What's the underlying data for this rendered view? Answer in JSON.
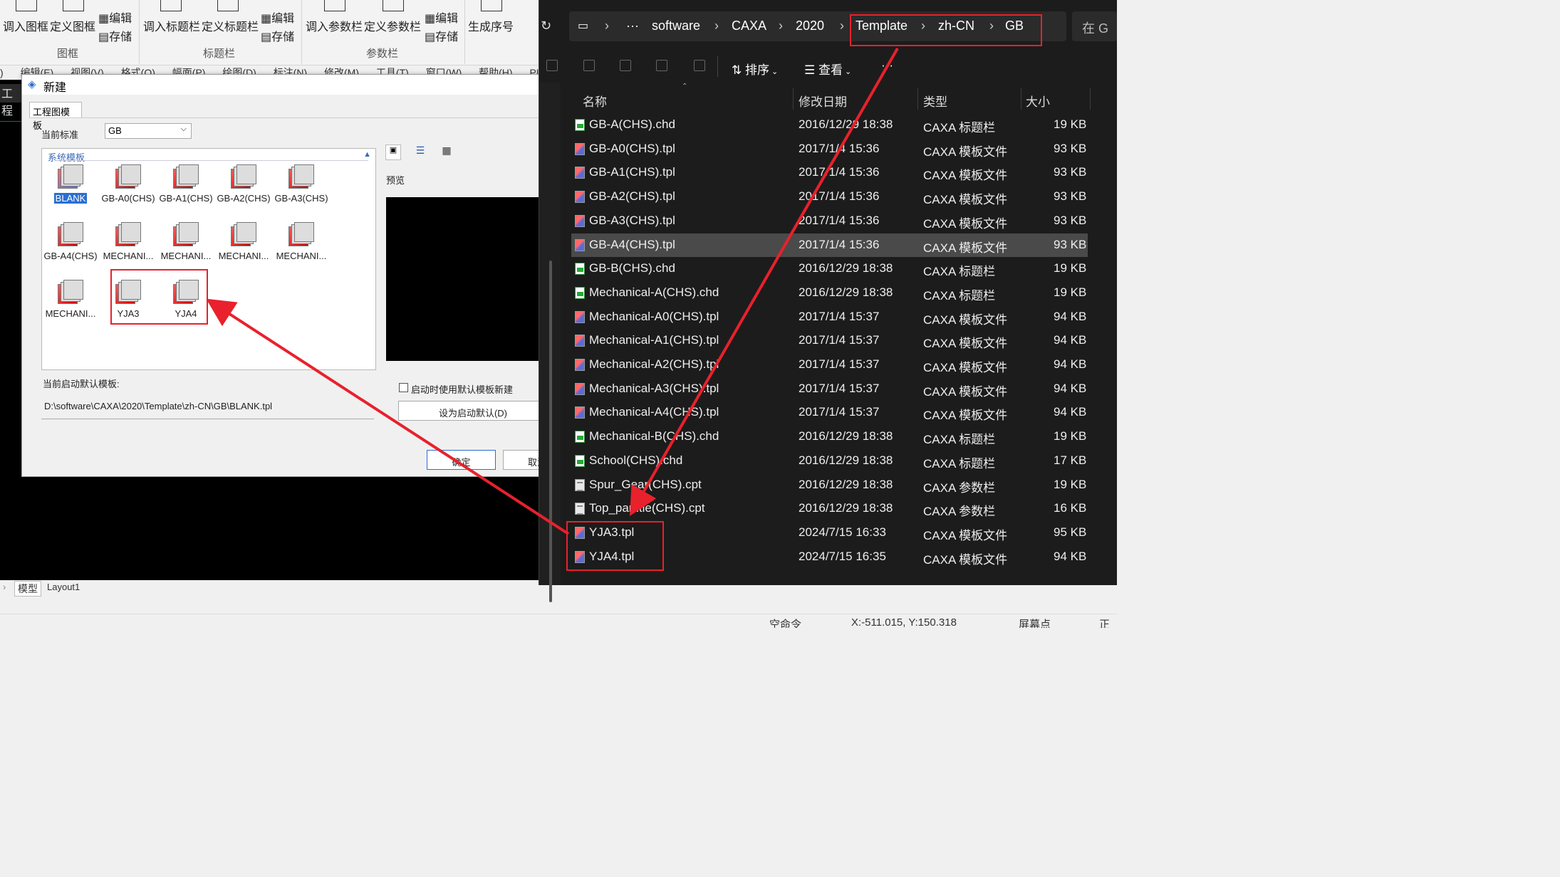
{
  "ribbon": {
    "groups": [
      {
        "name": "图框",
        "buttons": [
          "调入图框",
          "定义图框"
        ],
        "small": [
          "编辑",
          "存储"
        ]
      },
      {
        "name": "标题栏",
        "buttons": [
          "调入标题栏",
          "定义标题栏"
        ],
        "small": [
          "编辑",
          "存储"
        ]
      },
      {
        "name": "参数栏",
        "buttons": [
          "调入参数栏",
          "定义参数栏"
        ],
        "small": [
          "编辑",
          "存储"
        ]
      }
    ],
    "generate_serial": "生成序号"
  },
  "menubar": [
    "编辑(E)",
    "视图(V)",
    "格式(O)",
    "幅面(P)",
    "绘图(D)",
    "标注(N)",
    "修改(M)",
    "工具(T)",
    "窗口(W)",
    "帮助(H)",
    "PLM"
  ],
  "cad": {
    "project_label": "工程",
    "tabs": [
      "模型",
      "Layout1"
    ]
  },
  "status": {
    "command": "空命令",
    "coords": "X:-511.015, Y:150.318",
    "screen_point": "屏幕点",
    "ortho": "正交"
  },
  "dialog": {
    "title": "新建",
    "tab": "工程图模板",
    "current_standard_label": "当前标准",
    "current_standard_value": "GB",
    "system_templates_label": "系统模板",
    "templates": [
      "BLANK",
      "GB-A0(CHS)",
      "GB-A1(CHS)",
      "GB-A2(CHS)",
      "GB-A3(CHS)",
      "GB-A4(CHS)",
      "MECHANI...",
      "MECHANI...",
      "MECHANI...",
      "MECHANI...",
      "MECHANI...",
      "YJA3",
      "YJA4"
    ],
    "preview_label": "预览",
    "default_template_label": "当前启动默认模板:",
    "default_template_path": "D:\\software\\CAXA\\2020\\Template\\zh-CN\\GB\\BLANK.tpl",
    "checkbox_label": "启动时使用默认模板新建",
    "set_default_button": "设为启动默认(D)",
    "ok_button": "确定",
    "cancel_button": "取消"
  },
  "explorer": {
    "breadcrumb": [
      "software",
      "CAXA",
      "2020",
      "Template",
      "zh-CN",
      "GB"
    ],
    "search_placeholder": "在 G",
    "toolbar": {
      "sort": "排序",
      "view": "查看",
      "more": "···"
    },
    "columns": [
      "名称",
      "修改日期",
      "类型",
      "大小"
    ],
    "files": [
      {
        "name": "GB-A(CHS).chd",
        "date": "2016/12/29 18:38",
        "type": "CAXA 标题栏",
        "size": "19 KB",
        "kind": "chd"
      },
      {
        "name": "GB-A0(CHS).tpl",
        "date": "2017/1/4 15:36",
        "type": "CAXA 模板文件",
        "size": "93 KB",
        "kind": "tpl"
      },
      {
        "name": "GB-A1(CHS).tpl",
        "date": "2017/1/4 15:36",
        "type": "CAXA 模板文件",
        "size": "93 KB",
        "kind": "tpl"
      },
      {
        "name": "GB-A2(CHS).tpl",
        "date": "2017/1/4 15:36",
        "type": "CAXA 模板文件",
        "size": "93 KB",
        "kind": "tpl"
      },
      {
        "name": "GB-A3(CHS).tpl",
        "date": "2017/1/4 15:36",
        "type": "CAXA 模板文件",
        "size": "93 KB",
        "kind": "tpl"
      },
      {
        "name": "GB-A4(CHS).tpl",
        "date": "2017/1/4 15:36",
        "type": "CAXA 模板文件",
        "size": "93 KB",
        "kind": "tpl",
        "selected": true
      },
      {
        "name": "GB-B(CHS).chd",
        "date": "2016/12/29 18:38",
        "type": "CAXA 标题栏",
        "size": "19 KB",
        "kind": "chd"
      },
      {
        "name": "Mechanical-A(CHS).chd",
        "date": "2016/12/29 18:38",
        "type": "CAXA 标题栏",
        "size": "19 KB",
        "kind": "chd"
      },
      {
        "name": "Mechanical-A0(CHS).tpl",
        "date": "2017/1/4 15:37",
        "type": "CAXA 模板文件",
        "size": "94 KB",
        "kind": "tpl"
      },
      {
        "name": "Mechanical-A1(CHS).tpl",
        "date": "2017/1/4 15:37",
        "type": "CAXA 模板文件",
        "size": "94 KB",
        "kind": "tpl"
      },
      {
        "name": "Mechanical-A2(CHS).tpl",
        "date": "2017/1/4 15:37",
        "type": "CAXA 模板文件",
        "size": "94 KB",
        "kind": "tpl"
      },
      {
        "name": "Mechanical-A3(CHS).tpl",
        "date": "2017/1/4 15:37",
        "type": "CAXA 模板文件",
        "size": "94 KB",
        "kind": "tpl"
      },
      {
        "name": "Mechanical-A4(CHS).tpl",
        "date": "2017/1/4 15:37",
        "type": "CAXA 模板文件",
        "size": "94 KB",
        "kind": "tpl"
      },
      {
        "name": "Mechanical-B(CHS).chd",
        "date": "2016/12/29 18:38",
        "type": "CAXA 标题栏",
        "size": "19 KB",
        "kind": "chd"
      },
      {
        "name": "School(CHS).chd",
        "date": "2016/12/29 18:38",
        "type": "CAXA 标题栏",
        "size": "17 KB",
        "kind": "chd"
      },
      {
        "name": "Spur_Gear(CHS).cpt",
        "date": "2016/12/29 18:38",
        "type": "CAXA 参数栏",
        "size": "19 KB",
        "kind": "cpt"
      },
      {
        "name": "Top_partitle(CHS).cpt",
        "date": "2016/12/29 18:38",
        "type": "CAXA 参数栏",
        "size": "16 KB",
        "kind": "cpt"
      },
      {
        "name": "YJA3.tpl",
        "date": "2024/7/15 16:33",
        "type": "CAXA 模板文件",
        "size": "95 KB",
        "kind": "tpl"
      },
      {
        "name": "YJA4.tpl",
        "date": "2024/7/15 16:35",
        "type": "CAXA 模板文件",
        "size": "94 KB",
        "kind": "tpl"
      }
    ]
  },
  "annotation_color": "#e8212c"
}
